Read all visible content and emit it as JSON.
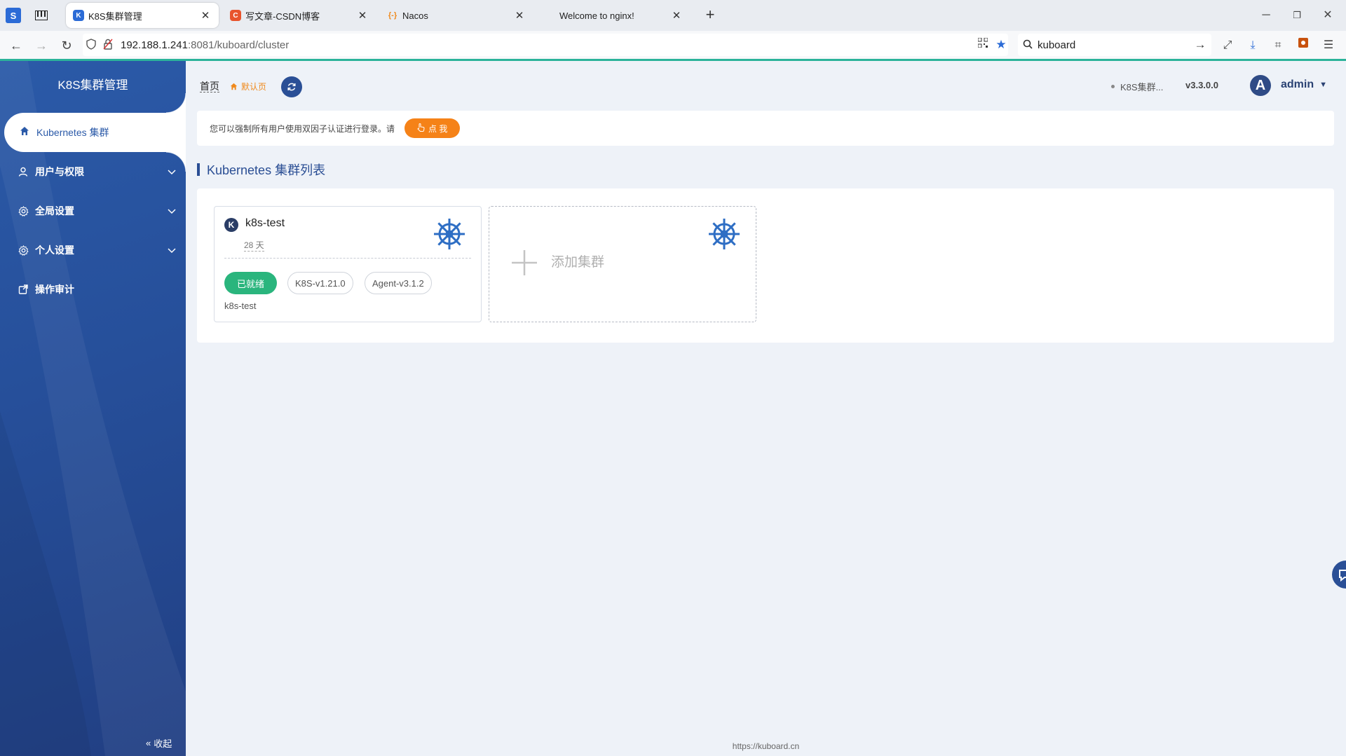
{
  "browser": {
    "tabs": [
      {
        "title": "K8S集群管理",
        "favicon": "K",
        "color": "#2b6bd6",
        "active": true
      },
      {
        "title": "写文章-CSDN博客",
        "favicon": "C",
        "color": "#e8542d",
        "active": false
      },
      {
        "title": "Nacos",
        "favicon": "{-}",
        "color": "#f08a1d",
        "active": false
      },
      {
        "title": "Welcome to nginx!",
        "favicon": "",
        "color": "",
        "active": false
      }
    ],
    "url": {
      "host": "192.188.1.241",
      "rest": ":8081/kuboard/cluster"
    },
    "search": {
      "value": "kuboard"
    }
  },
  "sidebar": {
    "title": "K8S集群管理",
    "active_item": {
      "label": "Kubernetes 集群",
      "icon": "home-icon"
    },
    "items": [
      {
        "label": "用户与权限",
        "icon": "user-icon"
      },
      {
        "label": "全局设置",
        "icon": "gear-icon"
      },
      {
        "label": "个人设置",
        "icon": "gear-icon"
      },
      {
        "label": "操作审计",
        "icon": "audit-icon"
      }
    ],
    "collapse_label": "收起"
  },
  "header": {
    "breadcrumb_home": "首页",
    "breadcrumb_default": "默认页",
    "cluster_chip": "K8S集群...",
    "version": "v3.3.0.0",
    "avatar_letter": "A",
    "username": "admin"
  },
  "notice": {
    "text": "您可以强制所有用户使用双因子认证进行登录。请",
    "button": "点 我"
  },
  "section": {
    "title": "Kubernetes 集群列表"
  },
  "cluster_card": {
    "name": "k8s-test",
    "age": "28 天",
    "status": "已就绪",
    "k8s_version": "K8S-v1.21.0",
    "agent_version": "Agent-v3.1.2",
    "description": "k8s-test"
  },
  "add_card": {
    "label": "添加集群"
  },
  "footer": {
    "url": "https://kuboard.cn"
  },
  "colors": {
    "sidebar": "#264f9a",
    "accent": "#2bb39a",
    "orange": "#f58218",
    "ready": "#2ab57d",
    "helm": "#2e6ec4"
  }
}
